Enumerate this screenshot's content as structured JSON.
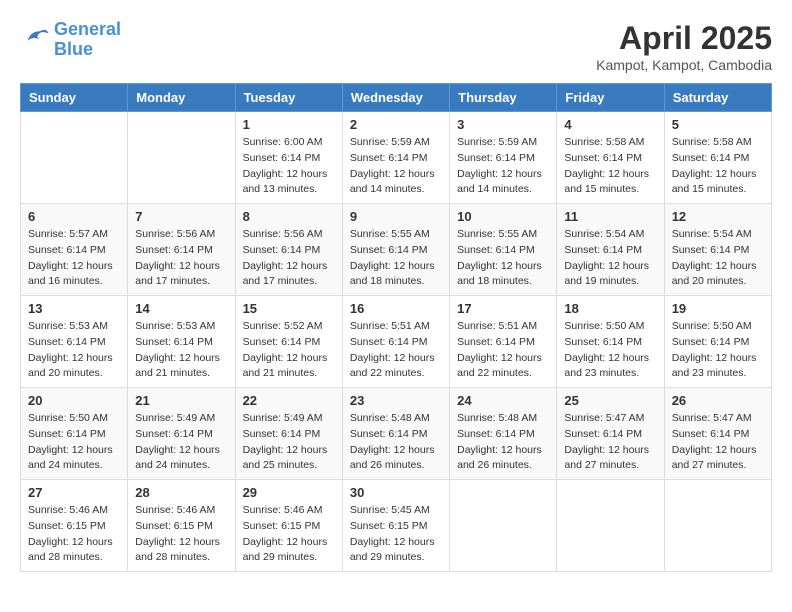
{
  "header": {
    "logo_line1": "General",
    "logo_line2": "Blue",
    "month_title": "April 2025",
    "location": "Kampot, Kampot, Cambodia"
  },
  "weekdays": [
    "Sunday",
    "Monday",
    "Tuesday",
    "Wednesday",
    "Thursday",
    "Friday",
    "Saturday"
  ],
  "weeks": [
    [
      {
        "day": "",
        "info": ""
      },
      {
        "day": "",
        "info": ""
      },
      {
        "day": "1",
        "info": "Sunrise: 6:00 AM\nSunset: 6:14 PM\nDaylight: 12 hours and 13 minutes."
      },
      {
        "day": "2",
        "info": "Sunrise: 5:59 AM\nSunset: 6:14 PM\nDaylight: 12 hours and 14 minutes."
      },
      {
        "day": "3",
        "info": "Sunrise: 5:59 AM\nSunset: 6:14 PM\nDaylight: 12 hours and 14 minutes."
      },
      {
        "day": "4",
        "info": "Sunrise: 5:58 AM\nSunset: 6:14 PM\nDaylight: 12 hours and 15 minutes."
      },
      {
        "day": "5",
        "info": "Sunrise: 5:58 AM\nSunset: 6:14 PM\nDaylight: 12 hours and 15 minutes."
      }
    ],
    [
      {
        "day": "6",
        "info": "Sunrise: 5:57 AM\nSunset: 6:14 PM\nDaylight: 12 hours and 16 minutes."
      },
      {
        "day": "7",
        "info": "Sunrise: 5:56 AM\nSunset: 6:14 PM\nDaylight: 12 hours and 17 minutes."
      },
      {
        "day": "8",
        "info": "Sunrise: 5:56 AM\nSunset: 6:14 PM\nDaylight: 12 hours and 17 minutes."
      },
      {
        "day": "9",
        "info": "Sunrise: 5:55 AM\nSunset: 6:14 PM\nDaylight: 12 hours and 18 minutes."
      },
      {
        "day": "10",
        "info": "Sunrise: 5:55 AM\nSunset: 6:14 PM\nDaylight: 12 hours and 18 minutes."
      },
      {
        "day": "11",
        "info": "Sunrise: 5:54 AM\nSunset: 6:14 PM\nDaylight: 12 hours and 19 minutes."
      },
      {
        "day": "12",
        "info": "Sunrise: 5:54 AM\nSunset: 6:14 PM\nDaylight: 12 hours and 20 minutes."
      }
    ],
    [
      {
        "day": "13",
        "info": "Sunrise: 5:53 AM\nSunset: 6:14 PM\nDaylight: 12 hours and 20 minutes."
      },
      {
        "day": "14",
        "info": "Sunrise: 5:53 AM\nSunset: 6:14 PM\nDaylight: 12 hours and 21 minutes."
      },
      {
        "day": "15",
        "info": "Sunrise: 5:52 AM\nSunset: 6:14 PM\nDaylight: 12 hours and 21 minutes."
      },
      {
        "day": "16",
        "info": "Sunrise: 5:51 AM\nSunset: 6:14 PM\nDaylight: 12 hours and 22 minutes."
      },
      {
        "day": "17",
        "info": "Sunrise: 5:51 AM\nSunset: 6:14 PM\nDaylight: 12 hours and 22 minutes."
      },
      {
        "day": "18",
        "info": "Sunrise: 5:50 AM\nSunset: 6:14 PM\nDaylight: 12 hours and 23 minutes."
      },
      {
        "day": "19",
        "info": "Sunrise: 5:50 AM\nSunset: 6:14 PM\nDaylight: 12 hours and 23 minutes."
      }
    ],
    [
      {
        "day": "20",
        "info": "Sunrise: 5:50 AM\nSunset: 6:14 PM\nDaylight: 12 hours and 24 minutes."
      },
      {
        "day": "21",
        "info": "Sunrise: 5:49 AM\nSunset: 6:14 PM\nDaylight: 12 hours and 24 minutes."
      },
      {
        "day": "22",
        "info": "Sunrise: 5:49 AM\nSunset: 6:14 PM\nDaylight: 12 hours and 25 minutes."
      },
      {
        "day": "23",
        "info": "Sunrise: 5:48 AM\nSunset: 6:14 PM\nDaylight: 12 hours and 26 minutes."
      },
      {
        "day": "24",
        "info": "Sunrise: 5:48 AM\nSunset: 6:14 PM\nDaylight: 12 hours and 26 minutes."
      },
      {
        "day": "25",
        "info": "Sunrise: 5:47 AM\nSunset: 6:14 PM\nDaylight: 12 hours and 27 minutes."
      },
      {
        "day": "26",
        "info": "Sunrise: 5:47 AM\nSunset: 6:14 PM\nDaylight: 12 hours and 27 minutes."
      }
    ],
    [
      {
        "day": "27",
        "info": "Sunrise: 5:46 AM\nSunset: 6:15 PM\nDaylight: 12 hours and 28 minutes."
      },
      {
        "day": "28",
        "info": "Sunrise: 5:46 AM\nSunset: 6:15 PM\nDaylight: 12 hours and 28 minutes."
      },
      {
        "day": "29",
        "info": "Sunrise: 5:46 AM\nSunset: 6:15 PM\nDaylight: 12 hours and 29 minutes."
      },
      {
        "day": "30",
        "info": "Sunrise: 5:45 AM\nSunset: 6:15 PM\nDaylight: 12 hours and 29 minutes."
      },
      {
        "day": "",
        "info": ""
      },
      {
        "day": "",
        "info": ""
      },
      {
        "day": "",
        "info": ""
      }
    ]
  ]
}
